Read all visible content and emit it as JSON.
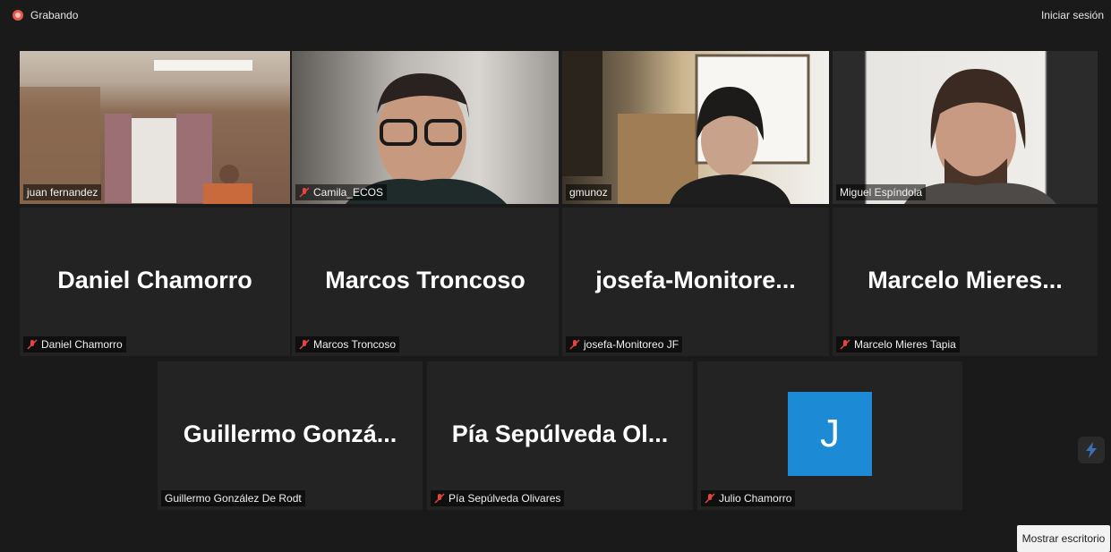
{
  "topbar": {
    "recording_label": "Grabando",
    "signin_label": "Iniciar sesión"
  },
  "participants": [
    {
      "name": "juan fernandez",
      "display": "",
      "muted": false,
      "video": true
    },
    {
      "name": "Camila_ECOS",
      "display": "",
      "muted": true,
      "video": true
    },
    {
      "name": "gmunoz",
      "display": "",
      "muted": false,
      "video": true
    },
    {
      "name": "Miguel Espíndola",
      "display": "",
      "muted": false,
      "video": true
    },
    {
      "name": "Daniel Chamorro",
      "display": "Daniel Chamorro",
      "muted": true,
      "video": false
    },
    {
      "name": "Marcos Troncoso",
      "display": "Marcos Troncoso",
      "muted": true,
      "video": false
    },
    {
      "name": "josefa-Monitoreo JF",
      "display": "josefa-Monitore...",
      "muted": true,
      "video": false
    },
    {
      "name": "Marcelo Mieres Tapia",
      "display": "Marcelo  Mieres...",
      "muted": true,
      "video": false
    },
    {
      "name": "Guillermo González De Rodt",
      "display": "Guillermo  Gonzá...",
      "muted": false,
      "video": false
    },
    {
      "name": "Pía Sepúlveda Olivares",
      "display": "Pía  Sepúlveda  Ol...",
      "muted": true,
      "video": false
    },
    {
      "name": "Julio Chamorro",
      "display": "",
      "avatar_letter": "J",
      "muted": true,
      "video": false
    }
  ],
  "footer": {
    "show_desktop_label": "Mostrar escritorio"
  },
  "colors": {
    "active_speaker_border": "#d4e27a",
    "avatar_bg": "#1d8ad6",
    "muted_icon": "#e5463b"
  }
}
